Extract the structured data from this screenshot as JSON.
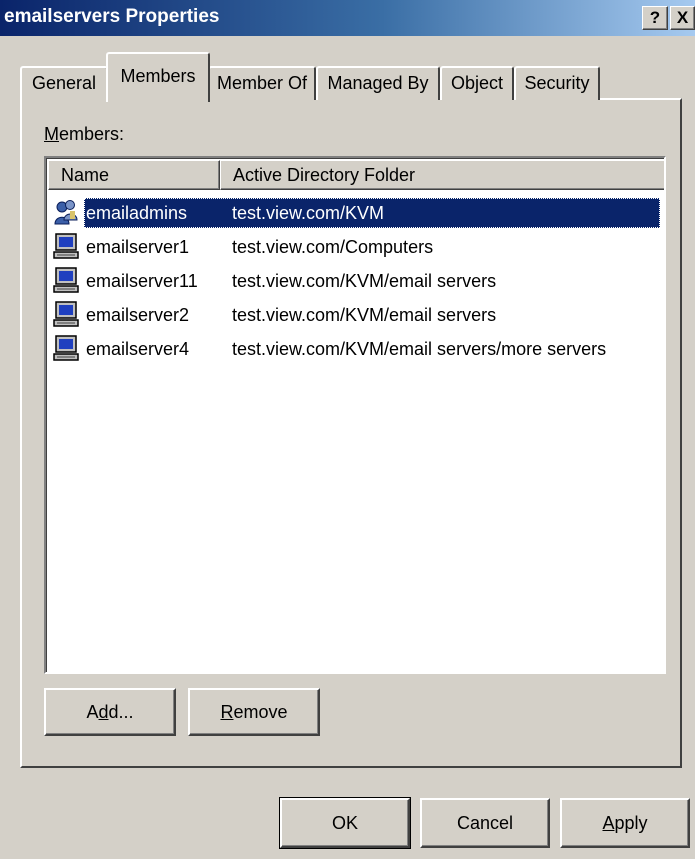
{
  "window": {
    "title": "emailservers Properties",
    "help_button": "?",
    "close_button": "X"
  },
  "tabs": [
    {
      "label": "General",
      "active": false
    },
    {
      "label": "Members",
      "active": true
    },
    {
      "label": "Member Of",
      "active": false
    },
    {
      "label": "Managed By",
      "active": false
    },
    {
      "label": "Object",
      "active": false
    },
    {
      "label": "Security",
      "active": false
    }
  ],
  "members": {
    "label_prefix": "M",
    "label_rest": "embers:",
    "columns": [
      "Name",
      "Active Directory Folder"
    ],
    "rows": [
      {
        "icon": "user-group-icon",
        "name": "emailadmins",
        "folder": "test.view.com/KVM",
        "selected": true
      },
      {
        "icon": "computer-icon",
        "name": "emailserver1",
        "folder": "test.view.com/Computers",
        "selected": false
      },
      {
        "icon": "computer-icon",
        "name": "emailserver11",
        "folder": "test.view.com/KVM/email servers",
        "selected": false
      },
      {
        "icon": "computer-icon",
        "name": "emailserver2",
        "folder": "test.view.com/KVM/email servers",
        "selected": false
      },
      {
        "icon": "computer-icon",
        "name": "emailserver4",
        "folder": "test.view.com/KVM/email servers/more servers",
        "selected": false
      }
    ]
  },
  "buttons": {
    "add_pre": "A",
    "add_ul": "d",
    "add_post": "d...",
    "remove_ul": "R",
    "remove_post": "emove",
    "ok": "OK",
    "cancel": "Cancel",
    "apply_ul": "A",
    "apply_post": "pply"
  },
  "colors": {
    "titlebar_start": "#0a246a",
    "titlebar_end": "#a6caf0",
    "selection": "#0a246a",
    "face": "#d4d0c8"
  }
}
